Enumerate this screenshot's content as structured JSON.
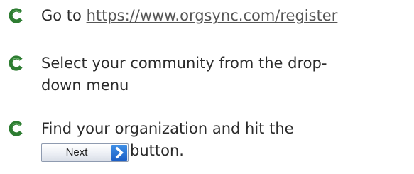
{
  "steps": [
    {
      "prefix": "Go to ",
      "link": "https://www.orgsync.com/register"
    },
    {
      "line1": "Select your community from the drop-",
      "line2": "down menu"
    },
    {
      "line1": "Find your organization and hit the",
      "button_label": "Next",
      "suffix": "button."
    }
  ],
  "colors": {
    "bullet": "#2e7d32",
    "text": "#2b2b2b",
    "link": "#555555",
    "button_arrow": "#1c5fc6"
  },
  "icons": {
    "bullet": "c-bullet-icon",
    "button_arrow": "chevron-right-icon"
  }
}
